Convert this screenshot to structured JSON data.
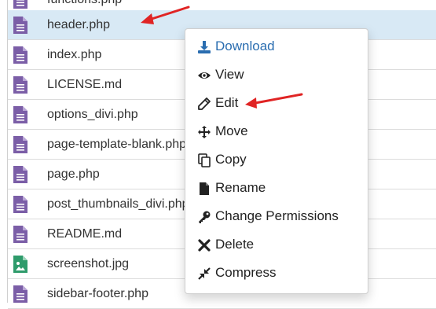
{
  "files": [
    {
      "name": "functions.php",
      "icon": "php-file-icon"
    },
    {
      "name": "header.php",
      "icon": "php-file-icon",
      "selected": true
    },
    {
      "name": "index.php",
      "icon": "php-file-icon"
    },
    {
      "name": "LICENSE.md",
      "icon": "text-file-icon"
    },
    {
      "name": "options_divi.php",
      "icon": "php-file-icon"
    },
    {
      "name": "page-template-blank.php",
      "icon": "php-file-icon"
    },
    {
      "name": "page.php",
      "icon": "php-file-icon"
    },
    {
      "name": "post_thumbnails_divi.php",
      "icon": "php-file-icon"
    },
    {
      "name": "README.md",
      "icon": "text-file-icon"
    },
    {
      "name": "screenshot.jpg",
      "icon": "image-file-icon"
    },
    {
      "name": "sidebar-footer.php",
      "icon": "php-file-icon"
    }
  ],
  "context_menu": {
    "items": [
      {
        "label": "Download",
        "icon": "download-icon"
      },
      {
        "label": "View",
        "icon": "eye-icon"
      },
      {
        "label": "Edit",
        "icon": "pencil-icon"
      },
      {
        "label": "Move",
        "icon": "move-arrows-icon"
      },
      {
        "label": "Copy",
        "icon": "copy-icon"
      },
      {
        "label": "Rename",
        "icon": "file-icon"
      },
      {
        "label": "Change Permissions",
        "icon": "key-icon"
      },
      {
        "label": "Delete",
        "icon": "close-icon"
      },
      {
        "label": "Compress",
        "icon": "compress-icon"
      }
    ]
  },
  "colors": {
    "file_icon": "#7b5ea7",
    "image_icon": "#2e9b6b",
    "selected_row": "#d8e9f5",
    "accent": "#2a6db0",
    "annotation_arrow": "#e02424"
  }
}
